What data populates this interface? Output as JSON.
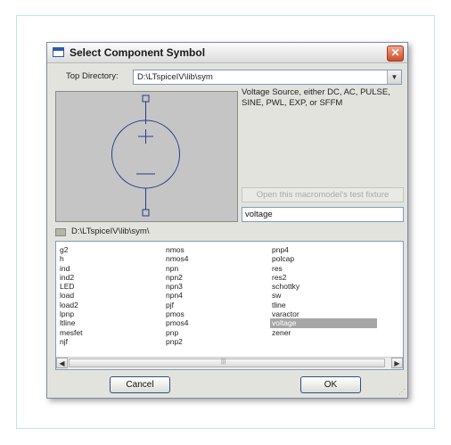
{
  "dialog": {
    "title": "Select Component Symbol",
    "close_glyph": "✕"
  },
  "top_directory": {
    "label": "Top Directory:",
    "value": "D:\\LTspiceIV\\lib\\sym",
    "arrow_glyph": "▼"
  },
  "description": "Voltage Source, either DC, AC, PULSE, SINE, PWL, EXP, or SFFM",
  "macromodel_button": "Open this macromodel's test fixture",
  "component_name": "voltage",
  "current_path": "D:\\LTspiceIV\\lib\\sym\\",
  "list": {
    "columns": [
      [
        "g2",
        "h",
        "ind",
        "ind2",
        "LED",
        "load",
        "load2",
        "lpnp",
        "ltline",
        "mesfet",
        "njf"
      ],
      [
        "nmos",
        "nmos4",
        "npn",
        "npn2",
        "npn3",
        "npn4",
        "pjf",
        "pmos",
        "pmos4",
        "pnp",
        "pnp2"
      ],
      [
        "pnp4",
        "polcap",
        "res",
        "res2",
        "schottky",
        "sw",
        "tline",
        "varactor",
        "voltage",
        "zener"
      ]
    ],
    "selected": "voltage"
  },
  "scroll": {
    "left_glyph": "◀",
    "right_glyph": "▶",
    "thumb_glyph": "|||"
  },
  "buttons": {
    "cancel": "Cancel",
    "ok": "OK"
  },
  "colors": {
    "selection": "#a6a6a6",
    "symbol_stroke": "#2a3a8c",
    "close_button": "#cf4c25"
  }
}
